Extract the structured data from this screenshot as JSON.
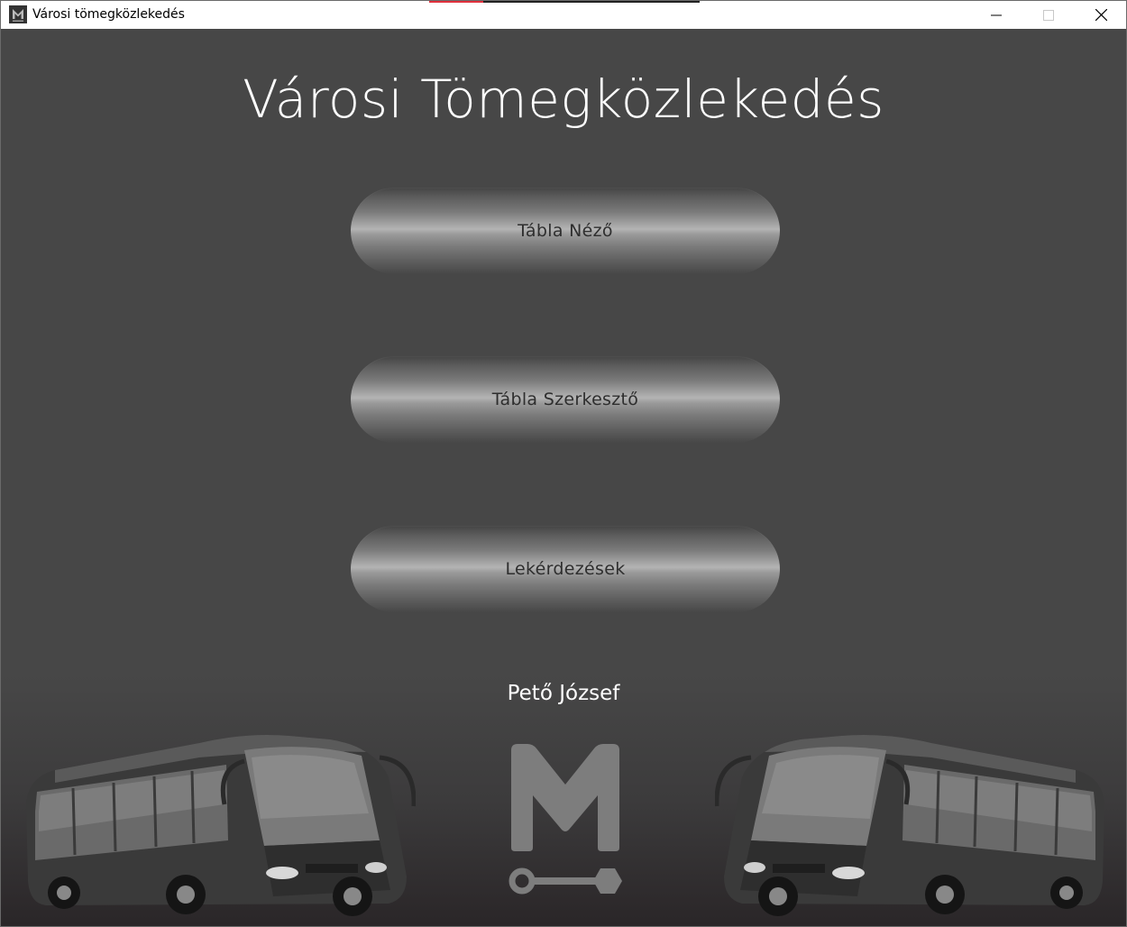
{
  "window": {
    "title": "Városi tömegközlekedés",
    "icon": "app-logo-icon"
  },
  "header": {
    "title": "Városi Tömegközlekedés"
  },
  "menu": {
    "items": [
      {
        "label": "Tábla Néző"
      },
      {
        "label": "Tábla Szerkesztő"
      },
      {
        "label": "Lekérdezések"
      }
    ]
  },
  "footer": {
    "author": "Pető József",
    "logo": "m-transit-logo",
    "images": [
      "bus-image-left",
      "bus-image-right"
    ]
  },
  "colors": {
    "background": "#474747",
    "title_text": "#ffffff",
    "button_text": "#2e2e2e",
    "logo": "#7d7d7d"
  }
}
